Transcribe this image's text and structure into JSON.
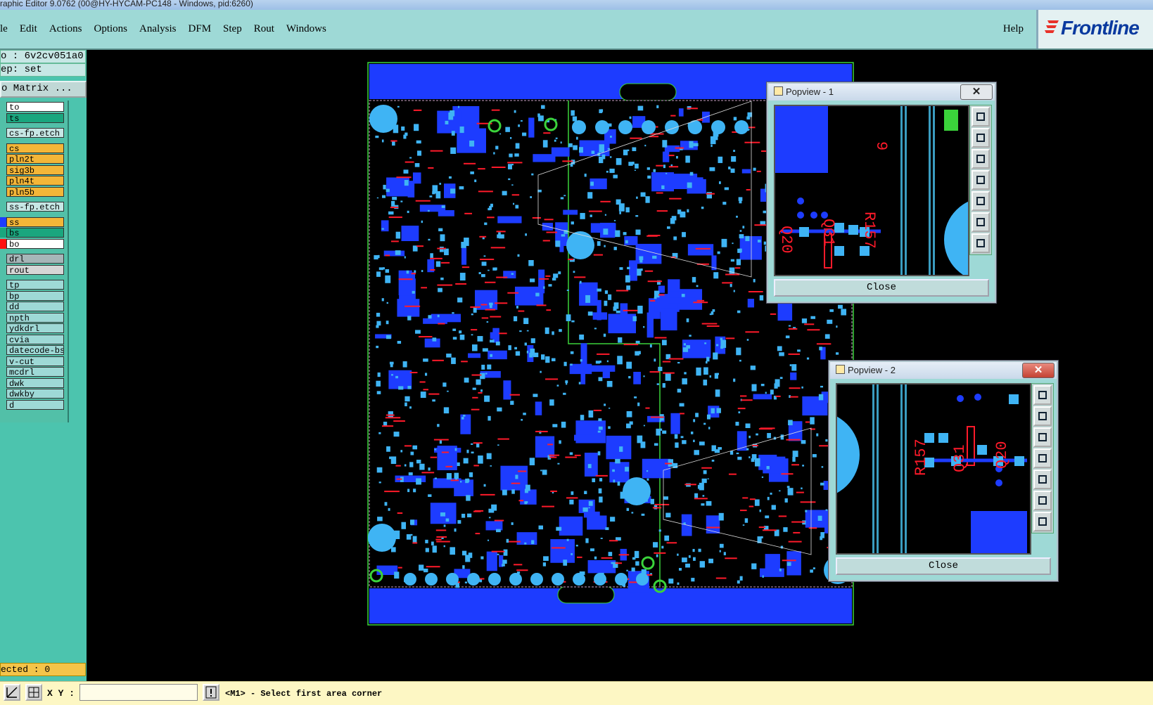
{
  "window": {
    "title": "raphic Editor 9.0762 (00@HY-HYCAM-PC148 - Windows, pid:6260)"
  },
  "menu": {
    "items": [
      "le",
      "Edit",
      "Actions",
      "Options",
      "Analysis",
      "DFM",
      "Step",
      "Rout",
      "Windows"
    ],
    "help": "Help",
    "brand": "Frontline"
  },
  "job": {
    "job_line": "o : 6v2cv051a0",
    "step_line": "ep: set",
    "matrix_button": "o Matrix ..."
  },
  "layers": [
    {
      "name": "to",
      "color": "#ffffff",
      "swatch": ""
    },
    {
      "name": "ts",
      "color": "#1aa67e",
      "swatch": ""
    },
    {
      "name": "cs-fp.etch",
      "color": "#c7e7e5",
      "swatch": ""
    },
    {
      "name": "cs",
      "color": "#f4b638",
      "swatch": ""
    },
    {
      "name": "pln2t",
      "color": "#f4b638",
      "swatch": ""
    },
    {
      "name": "sig3b",
      "color": "#f4b638",
      "swatch": ""
    },
    {
      "name": "pln4t",
      "color": "#f4b638",
      "swatch": ""
    },
    {
      "name": "pln5b",
      "color": "#f4b638",
      "swatch": ""
    },
    {
      "name": "ss-fp.etch",
      "color": "#c7e7e5",
      "swatch": ""
    },
    {
      "name": "ss",
      "color": "#f4b638",
      "swatch": "#1d3cff"
    },
    {
      "name": "bs",
      "color": "#1aa67e",
      "swatch": "#1aa67e"
    },
    {
      "name": "bo",
      "color": "#ffffff",
      "swatch": "#ff1010"
    },
    {
      "name": "drl",
      "color": "#a6b6b8",
      "swatch": ""
    },
    {
      "name": "rout",
      "color": "#d6d6d6",
      "swatch": ""
    },
    {
      "name": "tp",
      "color": "#9ed9d6",
      "swatch": ""
    },
    {
      "name": "bp",
      "color": "#9ed9d6",
      "swatch": ""
    },
    {
      "name": "dd",
      "color": "#9ed9d6",
      "swatch": ""
    },
    {
      "name": "npth",
      "color": "#9ed9d6",
      "swatch": ""
    },
    {
      "name": "ydkdrl",
      "color": "#9ed9d6",
      "swatch": ""
    },
    {
      "name": "cvia",
      "color": "#9ed9d6",
      "swatch": ""
    },
    {
      "name": "datecode-bs",
      "color": "#9ed9d6",
      "swatch": ""
    },
    {
      "name": "v-cut",
      "color": "#9ed9d6",
      "swatch": ""
    },
    {
      "name": "mcdrl",
      "color": "#9ed9d6",
      "swatch": ""
    },
    {
      "name": "dwk",
      "color": "#9ed9d6",
      "swatch": ""
    },
    {
      "name": "dwkby",
      "color": "#9ed9d6",
      "swatch": ""
    },
    {
      "name": "d",
      "color": "#9ed9d6",
      "swatch": ""
    }
  ],
  "selected_line": "ected : 0",
  "status": {
    "xy_label": "X Y :",
    "xy_value": "",
    "prompt": "<M1> - Select first area corner"
  },
  "popviews": [
    {
      "title": "Popview - 1",
      "close_button": "Close",
      "labels": [
        "Q20",
        "Q31",
        "R157",
        "9"
      ]
    },
    {
      "title": "Popview - 2",
      "close_button": "Close",
      "labels": [
        "R157",
        "Q31",
        "Q20"
      ]
    }
  ],
  "colors": {
    "board_blue": "#1d3cff",
    "pad_cyan": "#3fb4f4",
    "silk_red": "#ff1a2a",
    "outline_green": "#3bd33b"
  }
}
